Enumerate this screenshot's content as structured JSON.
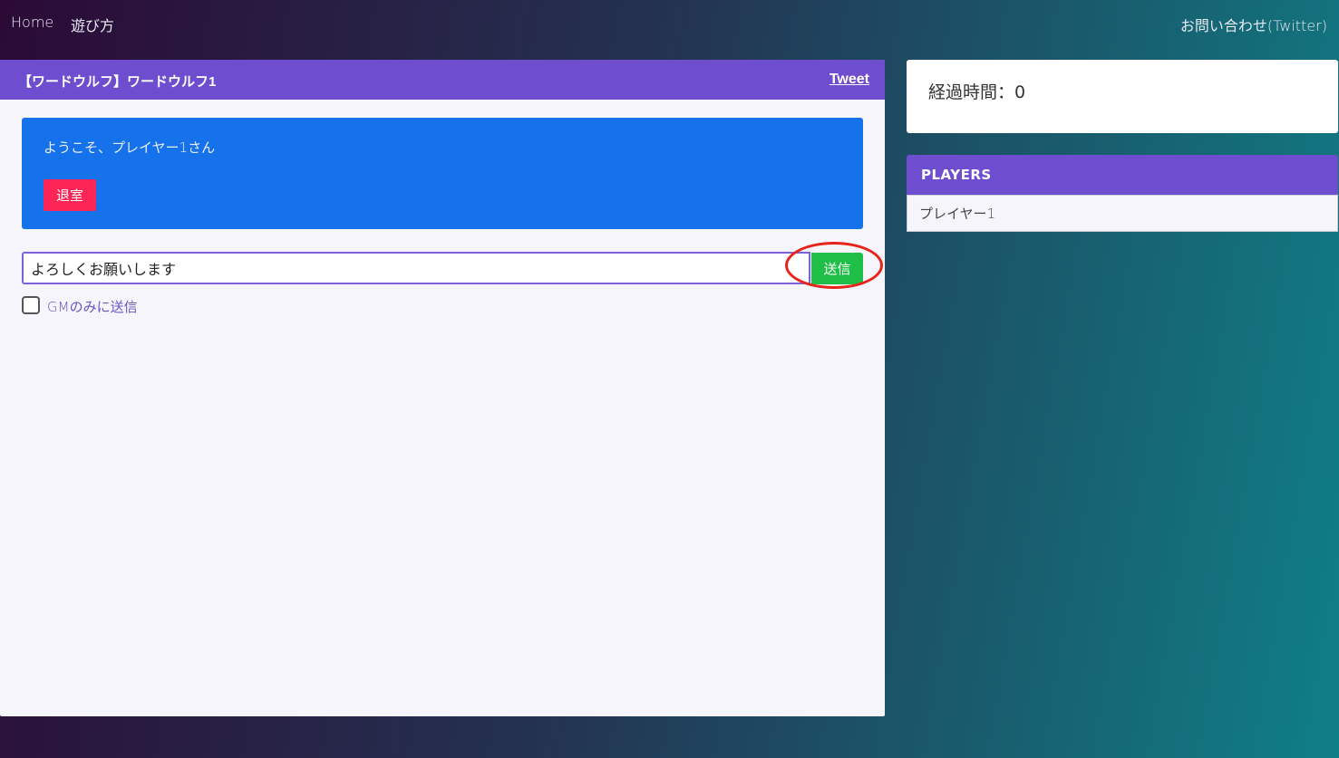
{
  "nav": {
    "home": "Home",
    "rules": "遊び方",
    "contact": "お問い合わせ(Twitter)"
  },
  "room": {
    "title": "【ワードウルフ】ワードウルフ1",
    "tweet": "Tweet",
    "welcome": "ようこそ、プレイヤー1さん",
    "leave": "退室"
  },
  "chat": {
    "value": "よろしくお願いします",
    "send": "送信",
    "gm_only_label": "GMのみに送信",
    "gm_only_checked": false
  },
  "timer": {
    "text": "経過時間：0"
  },
  "players": {
    "title": "PLAYERS",
    "items": [
      "プレイヤー1"
    ]
  },
  "colors": {
    "header_purple": "#6f4dcf",
    "welcome_blue": "#1672ea",
    "leave_red": "#fb2656",
    "send_green": "#1fbf47",
    "annotation_red": "#e8241a"
  }
}
